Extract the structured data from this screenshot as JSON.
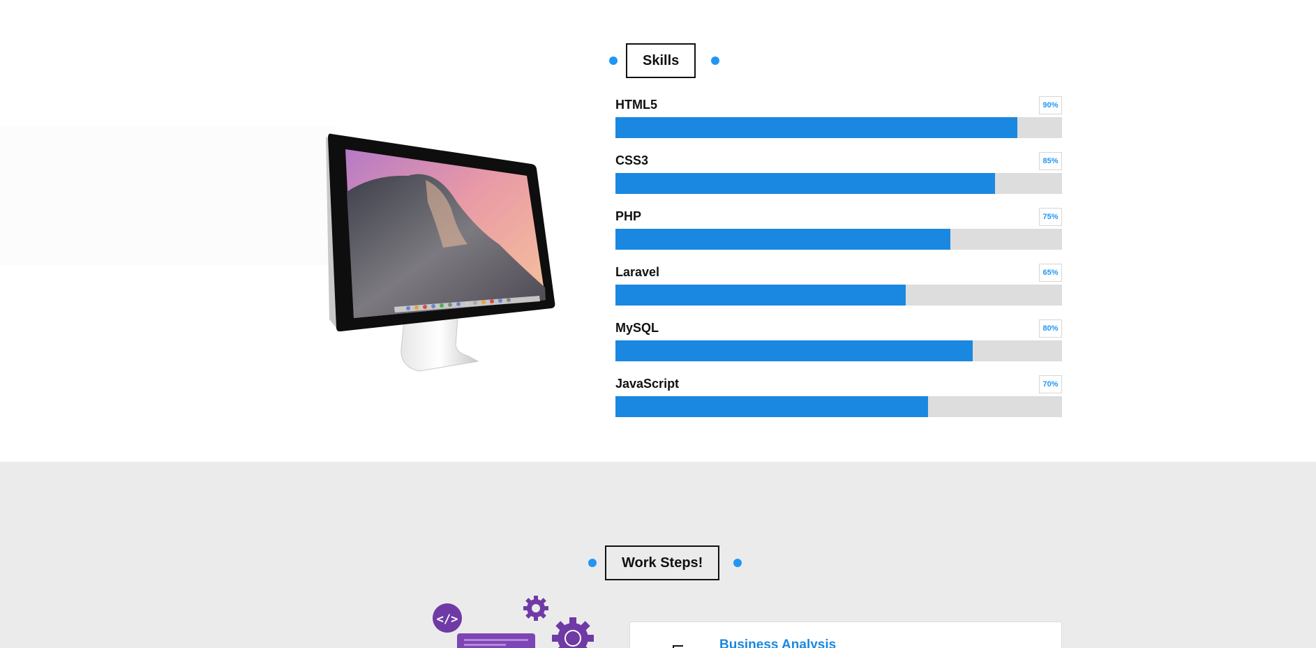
{
  "skills": {
    "title": "Skills",
    "items": [
      {
        "name": "HTML5",
        "percent_label": "90%",
        "value": 90
      },
      {
        "name": "CSS3",
        "percent_label": "85%",
        "value": 85
      },
      {
        "name": "PHP",
        "percent_label": "75%",
        "value": 75
      },
      {
        "name": "Laravel",
        "percent_label": "65%",
        "value": 65
      },
      {
        "name": "MySQL",
        "percent_label": "80%",
        "value": 80
      },
      {
        "name": "JavaScript",
        "percent_label": "70%",
        "value": 70
      }
    ]
  },
  "work_steps": {
    "title": "Work Steps!",
    "steps": [
      {
        "title": "Business Analysis"
      }
    ]
  },
  "colors": {
    "accent": "#2196f3",
    "bar_fill": "#1a88e0",
    "bar_track": "#dddddd",
    "illustration_purple": "#6f3aa5"
  },
  "icons": {
    "monitor": "imac-monitor-image",
    "code": "code-bracket-icon",
    "gear": "gear-icon",
    "step": "document-icon"
  }
}
